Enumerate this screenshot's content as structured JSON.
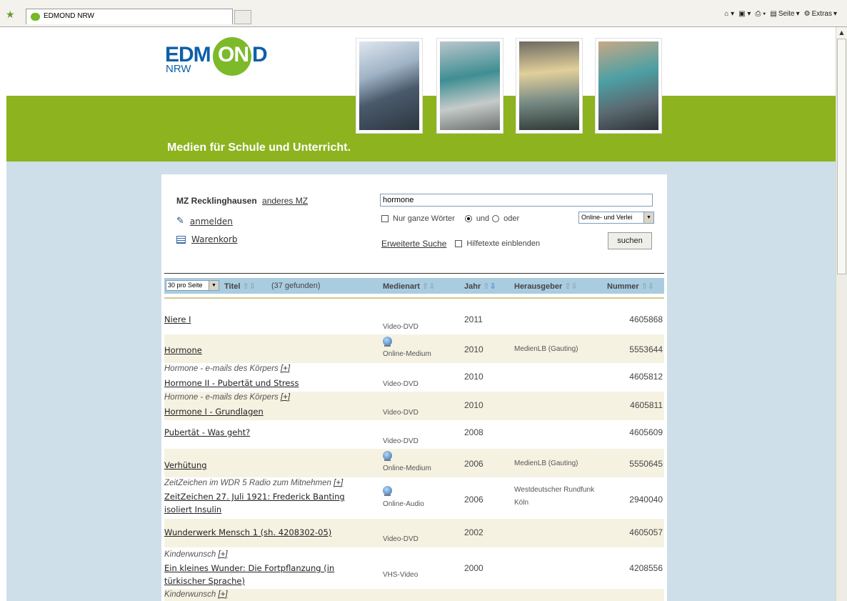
{
  "browser": {
    "tab_title": "EDMOND NRW",
    "tools": [
      "Seite",
      "Extras"
    ]
  },
  "header": {
    "logo": {
      "left": "EDM",
      "circle": "ON",
      "right": "D",
      "sub": "NRW"
    },
    "tagline": "Medien für Schule und Unterricht."
  },
  "sidebar": {
    "mz_label": "MZ Recklinghausen",
    "mz_change": "anderes MZ",
    "login": "anmelden",
    "cart": "Warenkorb"
  },
  "search": {
    "query": "hormone",
    "whole_words": "Nur ganze Wörter",
    "and_label": "und",
    "or_label": "oder",
    "media_select": "Online- und Verlei",
    "advanced": "Erweiterte Suche",
    "help_texts": "Hilfetexte einblenden",
    "submit": "suchen"
  },
  "table": {
    "per_page": "30 pro Seite",
    "col_title": "Titel",
    "found": "(37 gefunden)",
    "col_media": "Medienart",
    "col_year": "Jahr",
    "col_publisher": "Herausgeber",
    "col_number": "Nummer",
    "plus": "[+]",
    "rows": [
      {
        "serie": "",
        "title": "Niere I",
        "online": false,
        "media": "Video-DVD",
        "year": "2011",
        "publisher": "",
        "number": "4605868"
      },
      {
        "serie": "",
        "title": "Hormone",
        "online": true,
        "media": "Online-Medium",
        "year": "2010",
        "publisher": "MedienLB (Gauting)",
        "number": "5553644"
      },
      {
        "serie": "Hormone - e-mails des Körpers",
        "title": "Hormone II - Pubertät und Stress",
        "online": false,
        "media": "Video-DVD",
        "year": "2010",
        "publisher": "",
        "number": "4605812"
      },
      {
        "serie": "Hormone - e-mails des Körpers",
        "title": "Hormone I - Grundlagen",
        "online": false,
        "media": "Video-DVD",
        "year": "2010",
        "publisher": "",
        "number": "4605811"
      },
      {
        "serie": "",
        "title": "Pubertät - Was geht?",
        "online": false,
        "media": "Video-DVD",
        "year": "2008",
        "publisher": "",
        "number": "4605609"
      },
      {
        "serie": "",
        "title": "Verhütung",
        "online": true,
        "media": "Online-Medium",
        "year": "2006",
        "publisher": "MedienLB (Gauting)",
        "number": "5550645"
      },
      {
        "serie": "ZeitZeichen im WDR 5 Radio zum Mitnehmen",
        "title": "ZeitZeichen 27. Juli 1921: Frederick Banting isoliert Insulin",
        "online": true,
        "media": "Online-Audio",
        "year": "2006",
        "publisher": "Westdeutscher Rundfunk Köln",
        "number": "2940040"
      },
      {
        "serie": "",
        "title": "Wunderwerk Mensch 1 (sh. 4208302-05)",
        "online": false,
        "media": "Video-DVD",
        "year": "2002",
        "publisher": "",
        "number": "4605057"
      },
      {
        "serie": "Kinderwunsch",
        "title": "Ein kleines Wunder: Die Fortpflanzung (in türkischer Sprache)",
        "online": false,
        "media": "VHS-Video",
        "year": "2000",
        "publisher": "",
        "number": "4208556"
      },
      {
        "serie": "Kinderwunsch",
        "title": "",
        "online": false,
        "media": "",
        "year": "",
        "publisher": "",
        "number": ""
      }
    ]
  }
}
